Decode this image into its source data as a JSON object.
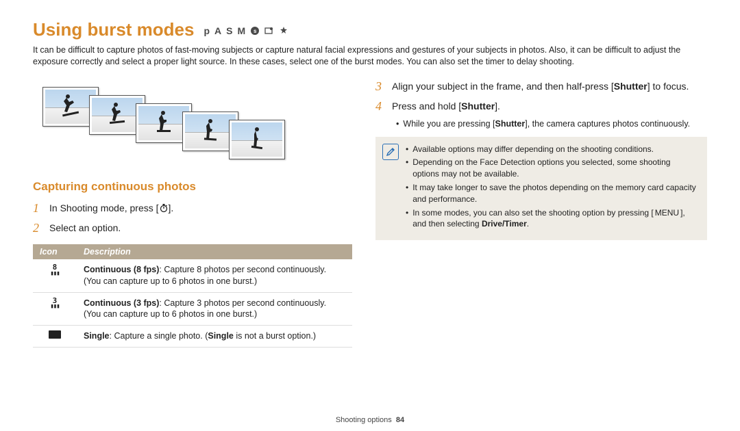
{
  "title": "Using burst modes",
  "mode_letters": [
    "p",
    "A",
    "S",
    "M"
  ],
  "mode_circle_letter": "s",
  "intro": "It can be difficult to capture photos of fast-moving subjects or capture natural facial expressions and gestures of your subjects in photos. Also, it can be difficult to adjust the exposure correctly and select a proper light source. In these cases, select one of the burst modes. You can also set the timer to delay shooting.",
  "subhead": "Capturing continuous photos",
  "steps_left": [
    {
      "n": "1",
      "text_a": "In Shooting mode, press [",
      "text_b": "]."
    },
    {
      "n": "2",
      "text_a": "Select an option.",
      "text_b": ""
    }
  ],
  "table": {
    "headers": [
      "Icon",
      "Description"
    ],
    "rows": [
      {
        "icon_top": "8",
        "icon_bars": "▮▮▮",
        "b": "Continuous (8 fps)",
        "t1": ": Capture 8 photos per second continuously.",
        "t2": "(You can capture up to 6 photos in one burst.)"
      },
      {
        "icon_top": "3",
        "icon_bars": "▮▮▮",
        "b": "Continuous (3 fps)",
        "t1": ": Capture 3 photos per second continuously.",
        "t2": "(You can capture up to 6 photos in one burst.)"
      },
      {
        "single": true,
        "b": "Single",
        "t1": ": Capture a single photo. (",
        "b2": "Single",
        "t2": " is not a burst option.)"
      }
    ]
  },
  "steps_right": [
    {
      "n": "3",
      "pre": "Align your subject in the frame, and then half-press [",
      "bold": "Shutter",
      "post": "] to focus."
    },
    {
      "n": "4",
      "pre": "Press and hold [",
      "bold": "Shutter",
      "post": "]."
    }
  ],
  "sub_bullet": {
    "a": "While you are pressing [",
    "b": "Shutter",
    "c": "], the camera captures photos continuously."
  },
  "notes": [
    {
      "text": "Available options may differ depending on the shooting conditions."
    },
    {
      "text": "Depending on the Face Detection options you selected, some shooting options may not be available."
    },
    {
      "text": "It may take longer to save the photos depending on the memory card capacity and performance."
    },
    {
      "pre": "In some modes, you can also set the shooting option by pressing [",
      "menu": "MENU",
      "mid": "], and then selecting ",
      "bold": "Drive/Timer",
      "post": "."
    }
  ],
  "footer": {
    "section": "Shooting options",
    "page": "84"
  }
}
